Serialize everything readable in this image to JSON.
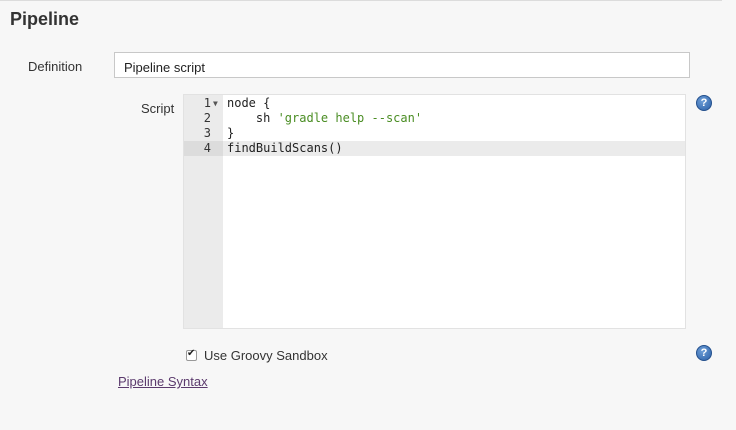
{
  "section": {
    "title": "Pipeline"
  },
  "definition": {
    "label": "Definition",
    "value": "Pipeline script"
  },
  "script": {
    "label": "Script",
    "lines": [
      {
        "num": "1",
        "code": "node {",
        "str": ""
      },
      {
        "num": "2",
        "code": "    sh ",
        "str": "'gradle help --scan'"
      },
      {
        "num": "3",
        "code": "}",
        "str": ""
      },
      {
        "num": "4",
        "code": "findBuildScans()",
        "str": ""
      }
    ],
    "active_line": 4
  },
  "sandbox": {
    "label": "Use Groovy Sandbox",
    "checked": true
  },
  "syntax_link": {
    "label": "Pipeline Syntax"
  },
  "help": {
    "glyph": "?"
  },
  "colors": {
    "link": "#5b3a6d",
    "string": "#4a8d23",
    "help": "#2b5fa6"
  }
}
